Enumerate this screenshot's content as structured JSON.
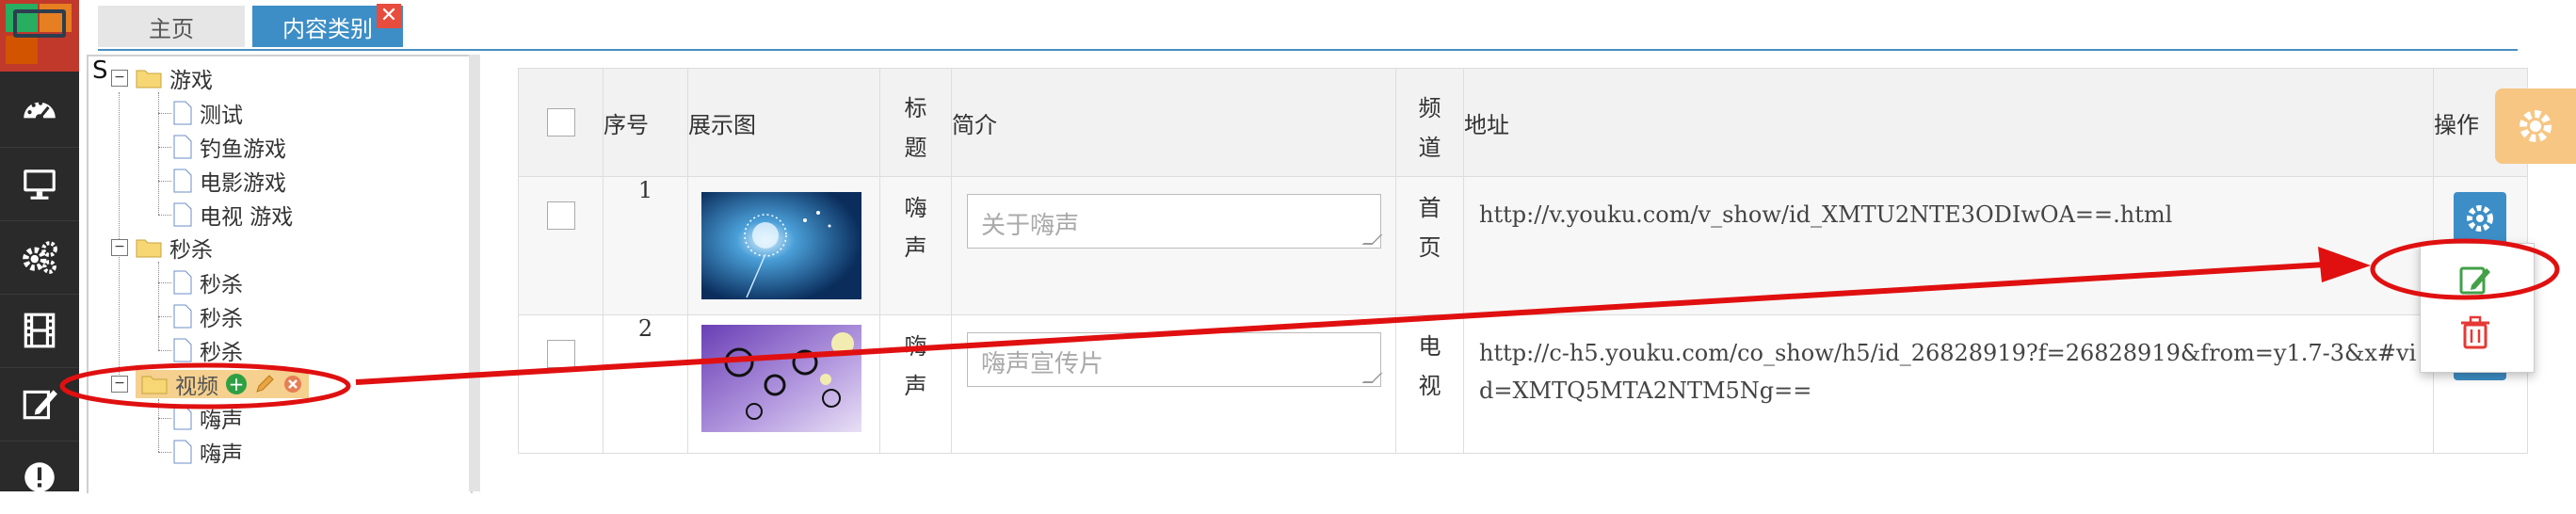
{
  "tabs": [
    {
      "label": "主页"
    },
    {
      "label": "内容类别"
    }
  ],
  "tab_close_glyph": "✕",
  "sidebar": {
    "icons": [
      "dashboard-icon",
      "monitor-icon",
      "settings-icon",
      "film-icon",
      "edit-icon",
      "alert-icon"
    ]
  },
  "tree": {
    "stray_text": "S",
    "nodes": [
      {
        "label": "游戏",
        "type": "folder",
        "children": [
          "测试",
          "钓鱼游戏",
          "电影游戏",
          "电视 游戏"
        ]
      },
      {
        "label": "秒杀",
        "type": "folder",
        "children": [
          "秒杀",
          "秒杀",
          "秒杀"
        ]
      },
      {
        "label": "视频",
        "type": "folder",
        "children": [
          "嗨声",
          "嗨声"
        ]
      }
    ],
    "add_glyph": "+"
  },
  "table": {
    "headers": {
      "seq": "序号",
      "image": "展示图",
      "title": "标题",
      "intro": "简介",
      "channel": "频道",
      "address": "地址",
      "action": "操作"
    },
    "rows": [
      {
        "seq": "1",
        "title": "嗨声",
        "intro_placeholder": "关于嗨声",
        "channel": "首页",
        "address": "http://v.youku.com/v_show/id_XMTU2NTE3ODIwOA==.html"
      },
      {
        "seq": "2",
        "title": "嗨声",
        "intro_placeholder": "嗨声宣传片",
        "channel": "电视",
        "address": "http://c-h5.youku.com/co_show/h5/id_26828919?f=26828919&from=y1.7-3&x#vid=XMTQ5MTA2NTM5Ng=="
      }
    ]
  },
  "colors": {
    "accent": "#3d8ec6",
    "annotation": "#e01010",
    "sidebar": "#2a2a2a",
    "highlight": "#f5d08e"
  }
}
